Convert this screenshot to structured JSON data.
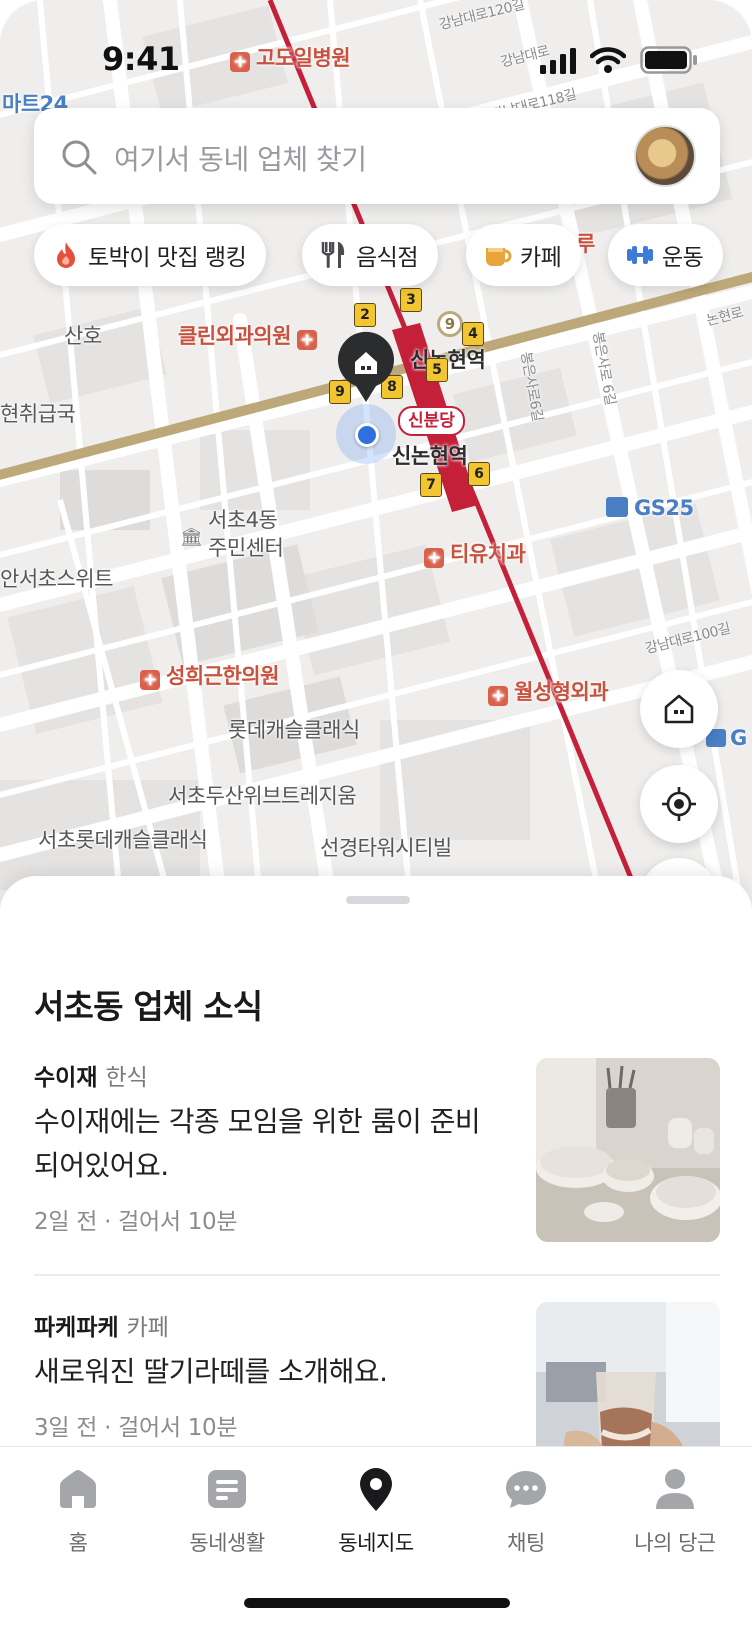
{
  "status_bar": {
    "time": "9:41"
  },
  "search": {
    "placeholder": "여기서 동네 업체 찾기"
  },
  "chips": [
    {
      "icon": "fire-icon",
      "label": "토박이 맛집 랭킹"
    },
    {
      "icon": "fork-knife-icon",
      "label": "음식점"
    },
    {
      "icon": "coffee-cup-icon",
      "label": "카페"
    },
    {
      "icon": "dumbbell-icon",
      "label": "운동"
    }
  ],
  "map": {
    "labels": {
      "hospital_top": "고도일병원",
      "mart": "마트24",
      "sanho": "산호",
      "clinic": "클린외과의원",
      "station_upper": "신논현역",
      "station_lower": "신논현역",
      "line_badge": "신분당",
      "line_number": "9",
      "emergency": "현취급국",
      "community": "서초4동\n주민센터",
      "gs25": "GS25",
      "dental": "티유치과",
      "suite": "안서초스위트",
      "korean_clinic": "성희근한의원",
      "ortho": "월성형외과",
      "lotte": "롯데캐슬클래식",
      "doosan": "서초두산위브트레지움",
      "lotte2": "서초롯데캐슬클래식",
      "sunkyung": "선경타워시티빌",
      "road_gangnam120": "강남대로120길",
      "road_gangnam118": "강남대로118길",
      "road_gangnam100": "강남대로100길",
      "road_bongeun": "봉은사로6길",
      "road_bongeun2": "봉은사로 6길",
      "road_nonhyeon": "논현로",
      "road_gangnam_top": "강남대로",
      "g_partial": "G",
      "ru_partial": "루"
    },
    "exits": [
      "2",
      "3",
      "4",
      "5",
      "6",
      "7",
      "8",
      "9"
    ]
  },
  "sheet": {
    "title": "서초동 업체 소식",
    "items": [
      {
        "name": "수이재",
        "category": "한식",
        "description": "수이재에는 각종 모임을 위한 룸이 준비 되어있어요.",
        "meta": "2일 전 · 걸어서 10분"
      },
      {
        "name": "파케파케",
        "category": "카페",
        "description": "새로워진 딸기라떼를 소개해요.",
        "meta": "3일 전 · 걸어서 10분"
      }
    ]
  },
  "tabs": [
    {
      "label": "홈",
      "icon": "home-icon"
    },
    {
      "label": "동네생활",
      "icon": "document-icon"
    },
    {
      "label": "동네지도",
      "icon": "map-pin-icon",
      "active": true
    },
    {
      "label": "채팅",
      "icon": "chat-bubble-icon"
    },
    {
      "label": "나의 당근",
      "icon": "person-icon"
    }
  ],
  "colors": {
    "accent": "#ff6f0f",
    "subway_line": "#c4203a",
    "line9": "#bda879",
    "location_blue": "#2f6fe0"
  }
}
